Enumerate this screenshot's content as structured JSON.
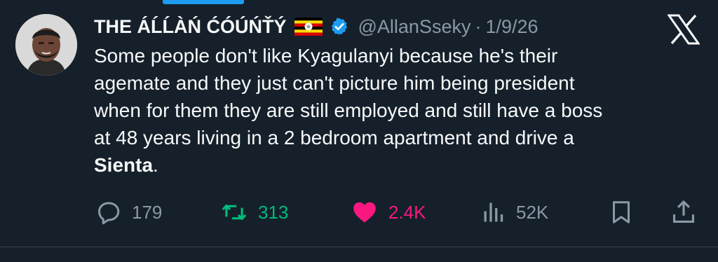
{
  "tweet": {
    "author_name": "THE ÁĹĹÀŃ ĆÓÚŃŤÝ",
    "flag_emoji": "🇺🇬",
    "handle": "@AllanSseky",
    "separator": "·",
    "date": "1/9/26",
    "text_lines": [
      "Some people don't like Kyagulanyi because he's their",
      "agemate and they just can't picture him being president",
      "when for them they are still employed and still have a boss",
      "at 48 years living in a 2 bedroom apartment and drive a"
    ],
    "text_bold": "Sienta",
    "text_end": ".",
    "replies": "179",
    "retweets": "313",
    "likes": "2.4K",
    "views": "52K"
  },
  "icons": {
    "reply": "reply-icon",
    "retweet": "retweet-icon",
    "like": "heart-icon",
    "views": "views-icon",
    "bookmark": "bookmark-icon",
    "share": "share-icon",
    "platform": "x-logo-icon",
    "verified": "verified-badge-icon"
  },
  "colors": {
    "background": "#15202b",
    "text": "#f7f9f9",
    "muted": "#8b98a5",
    "accent": "#1d9bf0",
    "retweet_green": "#00ba7c",
    "like_pink": "#f91880"
  }
}
